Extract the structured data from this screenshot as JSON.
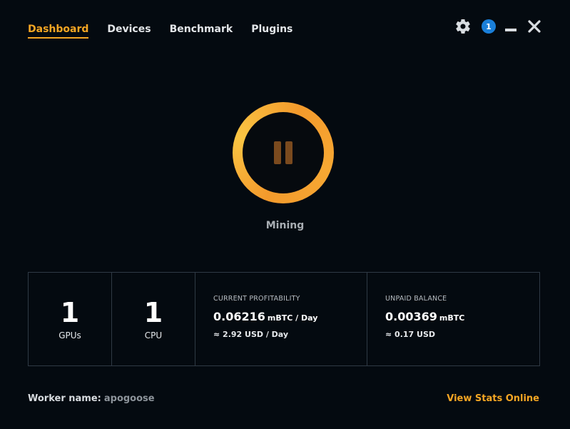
{
  "nav": {
    "items": [
      {
        "label": "Dashboard",
        "active": true
      },
      {
        "label": "Devices",
        "active": false
      },
      {
        "label": "Benchmark",
        "active": false
      },
      {
        "label": "Plugins",
        "active": false
      }
    ]
  },
  "window": {
    "notification_count": "1",
    "icons": [
      "gear-icon",
      "notification-badge",
      "minimize-icon",
      "close-icon"
    ]
  },
  "mining": {
    "status_label": "Mining",
    "button_icon": "pause-icon"
  },
  "stats": {
    "gpus": {
      "value": "1",
      "label": "GPUs"
    },
    "cpu": {
      "value": "1",
      "label": "CPU"
    },
    "profitability": {
      "title": "CURRENT PROFITABILITY",
      "value": "0.06216",
      "unit": "mBTC / Day",
      "sub": "≈ 2.92 USD / Day"
    },
    "balance": {
      "title": "UNPAID BALANCE",
      "value": "0.00369",
      "unit": "mBTC",
      "sub": "≈ 0.17 USD"
    }
  },
  "footer": {
    "worker_label": "Worker name:",
    "worker_value": "apogoose",
    "view_stats_label": "View Stats Online"
  },
  "colors": {
    "background": "#040a10",
    "accent": "#f5a623",
    "badge": "#1a7fd9",
    "border": "#2f3a45"
  }
}
